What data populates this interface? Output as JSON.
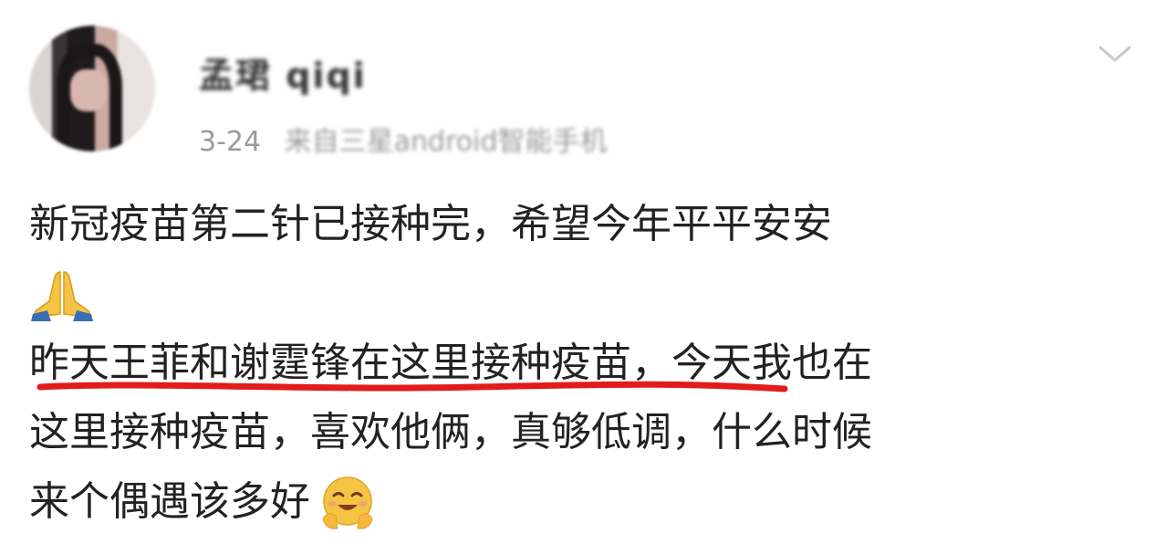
{
  "post": {
    "username": "孟珺 qiqi",
    "date": "3-24",
    "source_prefix": "来",
    "source": "自三星android智能手机",
    "lines": [
      "新冠疫苗第二针已接种完，希望今年平平安安",
      "昨天王菲和谢霆锋在这里接种疫苗，今天我也在",
      "这里接种疫苗，喜欢他俩，真够低调，什么时候",
      "来个偶遇该多好"
    ],
    "icons": {
      "menu": "chevron-down-icon",
      "pray": "folded-hands-emoji",
      "smile": "smiling-face-with-open-hands-emoji"
    },
    "colors": {
      "underline": "#e21b1b",
      "meta_text": "#9a9a9a"
    }
  }
}
